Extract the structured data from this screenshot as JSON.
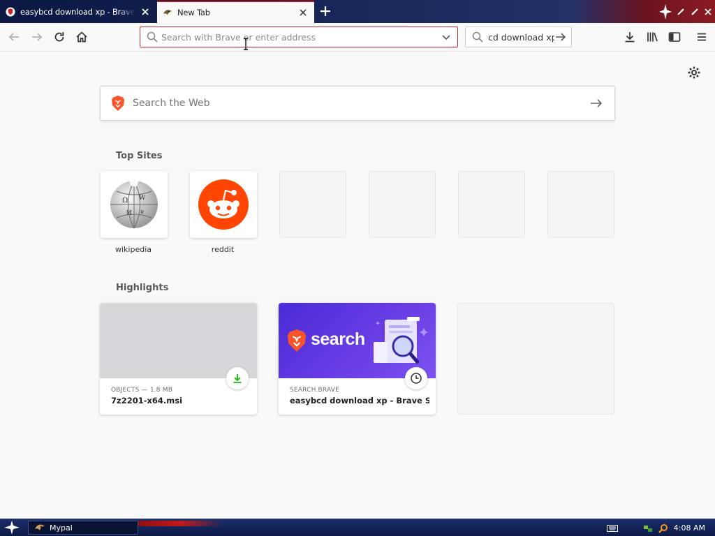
{
  "tabs": [
    {
      "title": "easybcd download xp - Brave Sea",
      "active": false
    },
    {
      "title": "New Tab",
      "active": true
    }
  ],
  "toolbar": {
    "url_placeholder": "Search with Brave or enter address",
    "search_value": "cd download xp"
  },
  "content": {
    "web_search_placeholder": "Search the Web",
    "top_sites_title": "Top Sites",
    "top_sites": [
      {
        "label": "wikipedia",
        "icon": "wikipedia-globe-icon"
      },
      {
        "label": "reddit",
        "icon": "reddit-alien-icon"
      }
    ],
    "highlights_title": "Highlights",
    "highlights": [
      {
        "meta": "OBJECTS — 1.8 MB",
        "title": "7z2201-x64.msi",
        "badge": "download-icon"
      },
      {
        "meta": "SEARCH.BRAVE",
        "title": "easybcd download xp - Brave Se...",
        "badge": "clock-icon",
        "thumb_text": "search"
      }
    ]
  },
  "taskbar": {
    "app_label": "Mypal",
    "clock": "4:08 AM"
  },
  "colors": {
    "url_focus_border": "#b22c2c",
    "reddit_orange": "#ff4500",
    "brave_orange": "#fb542b",
    "highlight_purple": "#5b3be0",
    "download_green": "#12bc00"
  }
}
